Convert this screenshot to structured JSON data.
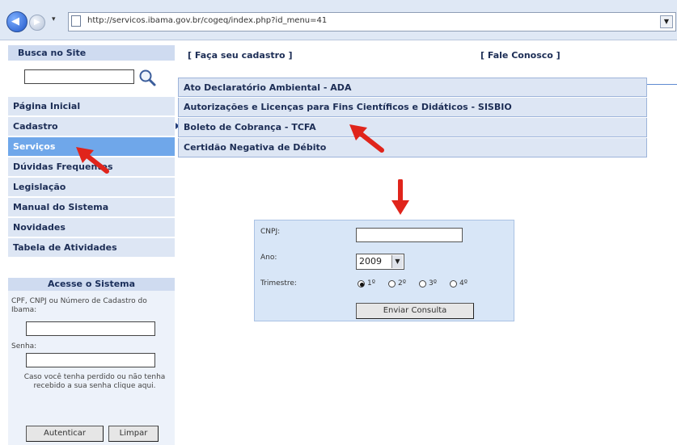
{
  "browser": {
    "url": "http://servicos.ibama.gov.br/cogeq/index.php?id_menu=41"
  },
  "search": {
    "heading": "Busca no Site"
  },
  "menu": [
    {
      "label": "Página Inicial"
    },
    {
      "label": "Cadastro"
    },
    {
      "label": "Serviços"
    },
    {
      "label": "Dúvidas Frequentes"
    },
    {
      "label": "Legislação"
    },
    {
      "label": "Manual do Sistema"
    },
    {
      "label": "Novidades"
    },
    {
      "label": "Tabela de Atividades"
    }
  ],
  "top_links": {
    "cadastro": "[ Faça seu cadastro ]",
    "fale": "[ Fale Conosco ]"
  },
  "submenu": [
    {
      "label": "Ato Declaratório Ambiental - ADA"
    },
    {
      "label": "Autorizações e Licenças para Fins Científicos e Didáticos - SISBIO"
    },
    {
      "label": "Boleto de Cobrança - TCFA"
    },
    {
      "label": "Certidão Negativa de Débito"
    }
  ],
  "login": {
    "heading": "Acesse o Sistema",
    "cpf_label": "CPF, CNPJ ou Número de Cadastro do Ibama:",
    "senha_label": "Senha:",
    "forgot_text": "Caso você tenha perdido ou não tenha recebido a sua senha clique aqui.",
    "auth_button": "Autenticar",
    "clear_button": "Limpar"
  },
  "form": {
    "cnpj_label": "CNPJ:",
    "ano_label": "Ano:",
    "ano_value": "2009",
    "trimestre_label": "Trimestre:",
    "trimestre_options": [
      "1º",
      "2º",
      "3º",
      "4º"
    ],
    "trimestre_selected": 0,
    "submit_label": "Enviar Consulta"
  },
  "colors": {
    "annotation_arrow": "#e0241b",
    "active_menu": "#6fa7ea",
    "menu_bg": "#dde6f4"
  }
}
